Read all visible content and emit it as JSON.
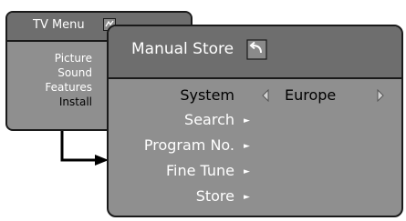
{
  "tv_menu": {
    "title": "TV Menu",
    "icon": "menu-exit-icon",
    "items": [
      {
        "label": "Picture",
        "selected": false
      },
      {
        "label": "Sound",
        "selected": false
      },
      {
        "label": "Features",
        "selected": false
      },
      {
        "label": "Install",
        "selected": true
      }
    ]
  },
  "manual_store": {
    "title": "Manual Store",
    "icon": "back-icon",
    "rows": [
      {
        "label": "System",
        "selected": true,
        "value": "Europe"
      },
      {
        "label": "Search",
        "selected": false
      },
      {
        "label": "Program No.",
        "selected": false
      },
      {
        "label": "Fine Tune",
        "selected": false
      },
      {
        "label": "Store",
        "selected": false
      }
    ]
  },
  "colors": {
    "panel_body": "#8f8f8f",
    "panel_header": "#6e6e6e",
    "text": "#ffffff",
    "selected_text": "#000000",
    "border": "#1a1a1a"
  }
}
